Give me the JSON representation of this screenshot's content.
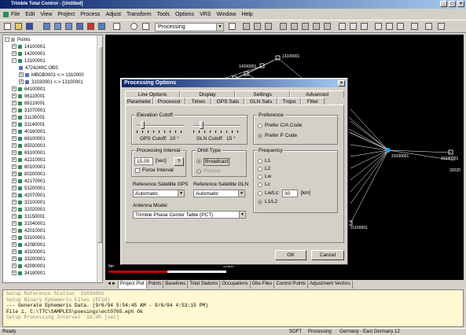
{
  "window": {
    "title": "Trimble Total Control - [Untitled]"
  },
  "menu": [
    "File",
    "Edit",
    "View",
    "Project",
    "Process",
    "Adjust",
    "Transform",
    "Tools",
    "Options",
    "VRS",
    "Window",
    "Help"
  ],
  "toolbar": {
    "mode_value": "Processing"
  },
  "tree": {
    "root": "Points",
    "items": [
      {
        "label": "14100001",
        "indent": 1,
        "expand": "+"
      },
      {
        "label": "14200001",
        "indent": 1,
        "expand": "+"
      },
      {
        "label": "13100001",
        "indent": 1,
        "expand": "-"
      },
      {
        "label": "4724249C.OBS",
        "indent": 2,
        "expand": ""
      },
      {
        "label": "MBOB0001 <-> 1310000",
        "indent": 2,
        "expand": "+"
      },
      {
        "label": "31030001 <-> 13100001",
        "indent": 2,
        "expand": "+"
      },
      {
        "label": "64100001",
        "indent": 1,
        "expand": "+"
      },
      {
        "label": "96110001",
        "indent": 1,
        "expand": "+"
      },
      {
        "label": "86110001",
        "indent": 1,
        "expand": "+"
      },
      {
        "label": "31070001",
        "indent": 1,
        "expand": "+"
      },
      {
        "label": "31130001",
        "indent": 1,
        "expand": "+"
      },
      {
        "label": "31140001",
        "indent": 1,
        "expand": "+"
      },
      {
        "label": "40160001",
        "indent": 1,
        "expand": "+"
      },
      {
        "label": "68100001",
        "indent": 1,
        "expand": "+"
      },
      {
        "label": "85020001",
        "indent": 1,
        "expand": "+"
      },
      {
        "label": "69100001",
        "indent": 1,
        "expand": "+"
      },
      {
        "label": "42210001",
        "indent": 1,
        "expand": "+"
      },
      {
        "label": "80100001",
        "indent": 1,
        "expand": "+"
      },
      {
        "label": "80200001",
        "indent": 1,
        "expand": "+"
      },
      {
        "label": "42170001",
        "indent": 1,
        "expand": "+"
      },
      {
        "label": "53200001",
        "indent": 1,
        "expand": "+"
      },
      {
        "label": "42070001",
        "indent": 1,
        "expand": "+"
      },
      {
        "label": "32100001",
        "indent": 1,
        "expand": "+"
      },
      {
        "label": "32020001",
        "indent": 1,
        "expand": "+"
      },
      {
        "label": "31150001",
        "indent": 1,
        "expand": "+"
      },
      {
        "label": "31040001",
        "indent": 1,
        "expand": "+"
      },
      {
        "label": "42010001",
        "indent": 1,
        "expand": "+"
      },
      {
        "label": "53100001",
        "indent": 1,
        "expand": "+"
      },
      {
        "label": "42080001",
        "indent": 1,
        "expand": "+"
      },
      {
        "label": "43100001",
        "indent": 1,
        "expand": "+"
      },
      {
        "label": "33200001",
        "indent": 1,
        "expand": "+"
      },
      {
        "label": "42090001",
        "indent": 1,
        "expand": "+"
      },
      {
        "label": "34180001",
        "indent": 1,
        "expand": "+"
      }
    ]
  },
  "plot": {
    "sites": [
      "13100001",
      "14200001",
      "31030001",
      "31040001",
      "32020",
      "31150001"
    ],
    "scale_label": "0m",
    "scale_label2": "5.0km"
  },
  "view_tabs": [
    "Project Plot",
    "Points",
    "Baselines",
    "Total Stations",
    "Occupations",
    "Obs-Files",
    "Control Points",
    "Adjustment Vectors"
  ],
  "console": [
    "Setup Reference Station  31030001",
    "Setup Binary Ephemeris Files (EF18)",
    "--- Generate Ephemeris Data. (9/6/94 5:54:45 AM - 9/6/94 4:53:15 PM)",
    "File 1. C:\\TTC\\SAMPLES\\poesings\\ect0765.eph Ok",
    "Setup Processing Interval  15.00 [sec]"
  ],
  "status": {
    "left": "Ready",
    "soft": "SOFT",
    "mode": "Processing",
    "proj": "Germany - East Germany 12"
  },
  "dialog": {
    "title": "Processing Options",
    "tabs_back": [
      "Line Options",
      "Display",
      "Settings",
      "Advanced"
    ],
    "tabs_front": [
      "Parameter",
      "Processor",
      "Times",
      "GPS Sats",
      "GLN Sats",
      "Tropo",
      "Filter"
    ],
    "elevation": {
      "title": "Elevation Cutoff",
      "gps_label": "GPS Cutoff:",
      "gps_value": "10 °",
      "gln_label": "GLN Cutoff:",
      "gln_value": "15 °",
      "gps_cutoff_deg": 10,
      "gln_cutoff_deg": 15
    },
    "preference": {
      "title": "Preference",
      "options": [
        "Prefer C/A Code",
        "Prefer P Code"
      ],
      "selected": 1
    },
    "interval": {
      "title": "Processing Interval",
      "value": "15.00",
      "unit": "[sec]",
      "help": "?",
      "force": "Force Interval"
    },
    "orbit": {
      "title": "Orbit Type",
      "options": [
        "Broadcast",
        "Precise"
      ],
      "selected": 0
    },
    "frequency": {
      "title": "Frequency",
      "options": [
        "L1",
        "L2",
        "Lw",
        "Lc",
        "Lw/Lc:",
        "L1/L2"
      ],
      "selected": 5,
      "lwlc_value": "30",
      "lwlc_unit": "[km]"
    },
    "ref_gps": {
      "label": "Reference Satellite GPS",
      "value": "Automatic"
    },
    "ref_gln": {
      "label": "Reference Satellite GLN",
      "value": "Automatic"
    },
    "antenna": {
      "label": "Antenna Model",
      "value": "Trimble Phase Center Table (PCT)"
    },
    "ok": "OK",
    "cancel": "Cancel"
  }
}
